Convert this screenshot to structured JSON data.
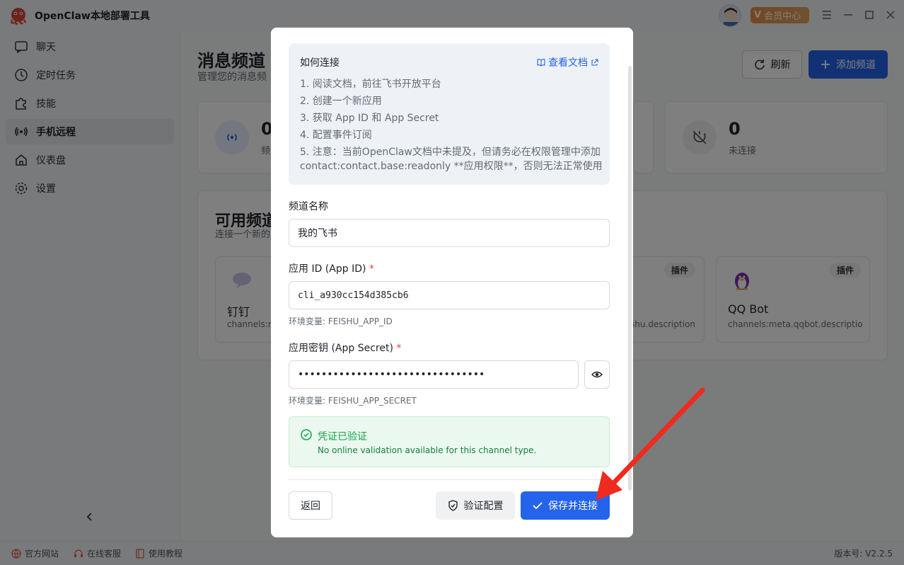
{
  "app": {
    "title": "OpenClaw本地部署工具",
    "vip_label": "会员中心",
    "vip_mark": "V"
  },
  "sidebar": {
    "items": [
      {
        "label": "聊天",
        "icon": "chat-icon"
      },
      {
        "label": "定时任务",
        "icon": "clock-icon"
      },
      {
        "label": "技能",
        "icon": "puzzle-icon"
      },
      {
        "label": "手机远程",
        "icon": "radio-icon",
        "active": true
      },
      {
        "label": "仪表盘",
        "icon": "home-icon"
      },
      {
        "label": "设置",
        "icon": "gear-icon"
      }
    ]
  },
  "footer": {
    "links": [
      "官方网站",
      "在线客服",
      "使用教程"
    ],
    "version": "版本号: V2.2.5"
  },
  "main": {
    "title": "消息频道",
    "subtitle": "管理您的消息频",
    "refresh_label": "刷新",
    "add_label": "添加频道",
    "stats": [
      {
        "value": "0",
        "label": "频"
      },
      {
        "value": "0",
        "label": "未连接"
      }
    ],
    "available_title": "可用频道",
    "available_sub": "连接一个新的",
    "channels": [
      {
        "name": "钉钉",
        "desc": "channels:meta",
        "tag": ""
      },
      {
        "name": "",
        "desc": "shu.description",
        "tag": "插件"
      },
      {
        "name": "QQ Bot",
        "desc": "channels:meta.qqbot.description",
        "tag": "插件"
      }
    ]
  },
  "modal": {
    "howto_title": "如何连接",
    "doc_link": "查看文档",
    "steps": [
      "1. 阅读文档，前往飞书开放平台",
      "2. 创建一个新应用",
      "3. 获取 App ID 和 App Secret",
      "4. 配置事件订阅",
      "5. 注意：当前OpenClaw文档中未提及，但请务必在权限管理中添加",
      "contact:contact.base:readonly **应用权限**，否则无法正常使用"
    ],
    "name_label": "频道名称",
    "name_value": "我的飞书",
    "app_id_label": "应用 ID (App ID)",
    "app_id_value": "cli_a930cc154d385cb6",
    "app_id_hint": "环境变量: FEISHU_APP_ID",
    "secret_label": "应用密钥 (App Secret)",
    "secret_value": "••••••••••••••••••••••••••••••••",
    "secret_hint": "环境变量: FEISHU_APP_SECRET",
    "required_mark": "*",
    "verified_title": "凭证已验证",
    "verified_msg": "No online validation available for this channel type.",
    "back_label": "返回",
    "verify_label": "验证配置",
    "save_label": "保存并连接"
  },
  "colors": {
    "accent": "#2563eb",
    "success": "#16a34a",
    "annotation_arrow": "#ee2b1e"
  }
}
